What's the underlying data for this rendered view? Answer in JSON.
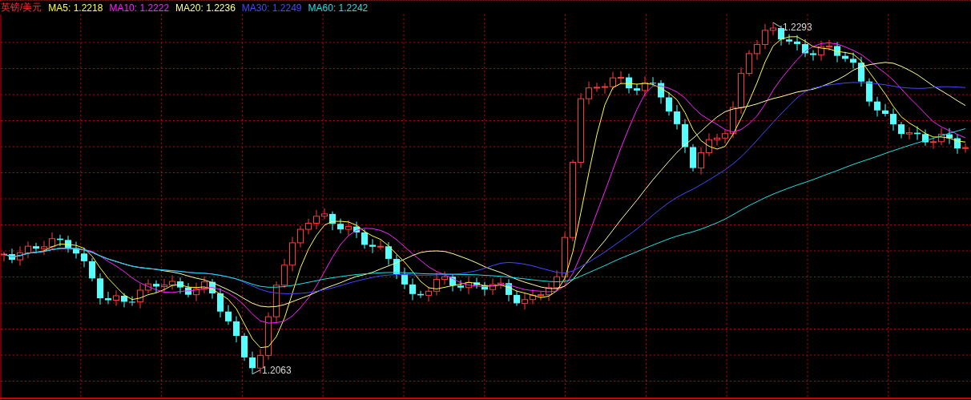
{
  "chart": {
    "title": "英镑/美元",
    "indicators": [
      {
        "label": "MA5: 1.2218",
        "color": "#ffff40"
      },
      {
        "label": "MA10: 1.2222",
        "color": "#ff20ff"
      },
      {
        "label": "MA20: 1.2236",
        "color": "#ffffa0"
      },
      {
        "label": "MA30: 1.2249",
        "color": "#4848ff"
      },
      {
        "label": "MA60: 1.2242",
        "color": "#20e0e0"
      }
    ],
    "annotations": [
      {
        "kind": "high",
        "label": "1.2293"
      },
      {
        "kind": "low",
        "label": "1.2063"
      }
    ]
  }
}
